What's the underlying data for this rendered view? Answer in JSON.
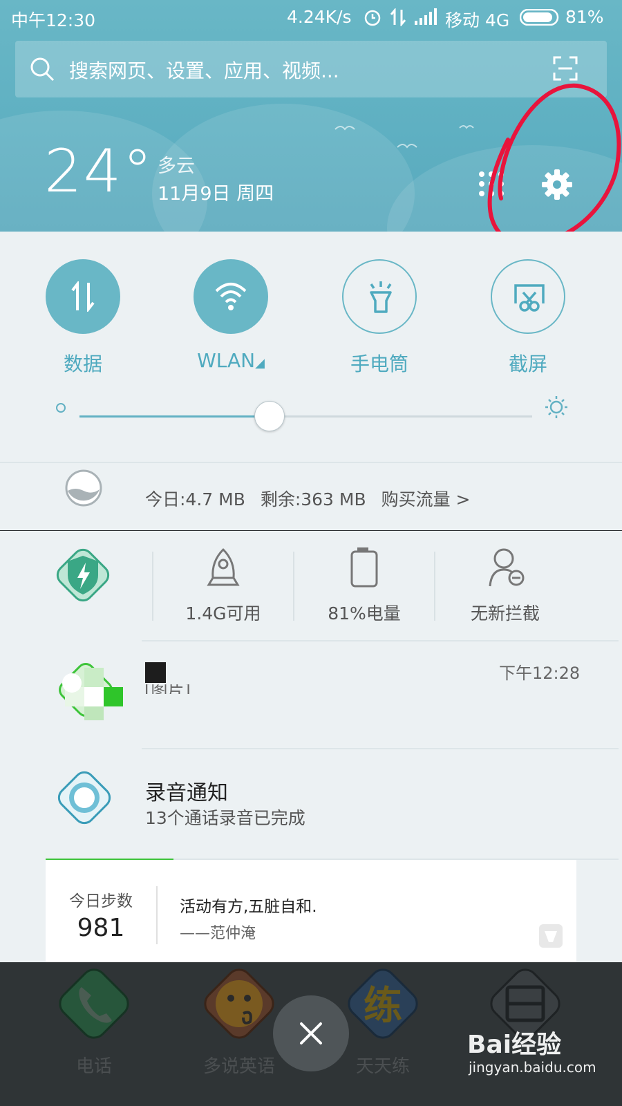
{
  "status_bar": {
    "time": "中午12:30",
    "net_speed": "4.24K/s",
    "carrier": "移动 4G",
    "battery": "81%"
  },
  "search": {
    "placeholder": "搜索网页、设置、应用、视频..."
  },
  "weather": {
    "temperature": "24°",
    "condition": "多云",
    "date": "11月9日 周四"
  },
  "quick_settings": {
    "toggles": [
      {
        "label": "数据",
        "icon": "mobile-data-icon",
        "on": true
      },
      {
        "label": "WLAN",
        "icon": "wifi-icon",
        "on": true
      },
      {
        "label": "手电筒",
        "icon": "flashlight-icon",
        "on": false
      },
      {
        "label": "截屏",
        "icon": "screenshot-icon",
        "on": false
      }
    ],
    "brightness_fraction": 0.42,
    "traffic": {
      "today": "今日:4.7 MB",
      "remaining": "剩余:363 MB",
      "buy": "购买流量 >"
    }
  },
  "security": {
    "stats": [
      {
        "label": "1.4G可用",
        "icon": "rocket-icon"
      },
      {
        "label": "81%电量",
        "icon": "battery-icon"
      },
      {
        "label": "无新拦截",
        "icon": "user-block-icon"
      }
    ]
  },
  "notifications": [
    {
      "app_icon": "wechat-icon",
      "title": "",
      "text": "[图片]",
      "time": "下午12:28"
    },
    {
      "app_icon": "recorder-icon",
      "title": "录音通知",
      "text": "13个通话录音已完成",
      "time": ""
    }
  ],
  "steps_card": {
    "label": "今日步数",
    "count": "981",
    "quote": "活动有方,五脏自和.",
    "author": "——范仲淹"
  },
  "dock": {
    "apps": [
      {
        "label": "电话",
        "icon": "phone-icon"
      },
      {
        "label": "多说英语",
        "icon": "english-app-icon"
      },
      {
        "label": "天天练",
        "icon": "practice-app-icon"
      },
      {
        "label": "",
        "icon": "scanner-app-icon"
      }
    ]
  },
  "watermark": {
    "brand": "Bai经验",
    "url": "jingyan.baidu.com"
  },
  "colors": {
    "accent": "#69b7c6",
    "annotation_red": "#e8143c",
    "panel_bg": "#ecf1f3"
  }
}
